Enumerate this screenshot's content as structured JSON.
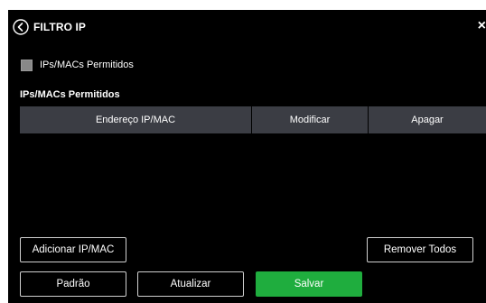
{
  "header": {
    "title": "FILTRO IP",
    "back_icon": "back-circle-icon",
    "close_label": "×"
  },
  "filter": {
    "checkbox_label": "IPs/MACs Permitidos",
    "checked": false
  },
  "section": {
    "title": "IPs/MACs Permitidos"
  },
  "table": {
    "columns": [
      "Endereço IP/MAC",
      "Modificar",
      "Apagar"
    ],
    "rows": []
  },
  "buttons": {
    "add": "Adicionar IP/MAC",
    "remove_all": "Remover Todos",
    "default": "Padrão",
    "refresh": "Atualizar",
    "save": "Salvar"
  },
  "colors": {
    "background": "#000000",
    "header_bg": "#3b3d44",
    "save_bg": "#1fad3e"
  }
}
